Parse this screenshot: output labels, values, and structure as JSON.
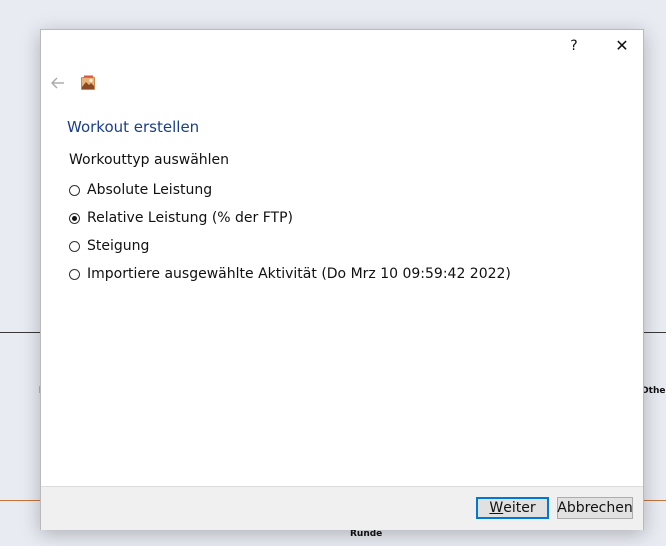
{
  "background": {
    "label_right": "Other",
    "label_left": "l",
    "label_bottom": "Runde"
  },
  "dialog": {
    "help_label": "?",
    "close_label": "✕",
    "heading": "Workout erstellen",
    "group_label": "Workouttyp auswählen",
    "options": [
      {
        "label": "Absolute Leistung",
        "checked": false
      },
      {
        "label": "Relative Leistung (% der FTP)",
        "checked": true
      },
      {
        "label": "Steigung",
        "checked": false
      },
      {
        "label": "Importiere ausgewählte Aktivität (Do Mrz 10 09:59:42 2022)",
        "checked": false
      }
    ],
    "buttons": {
      "next_mnemonic": "W",
      "next_rest": "eiter",
      "cancel": "Abbrechen"
    }
  },
  "colors": {
    "heading": "#1b3e8c",
    "accent_border": "#0078d7",
    "footer_bg": "#f0f0f0"
  }
}
